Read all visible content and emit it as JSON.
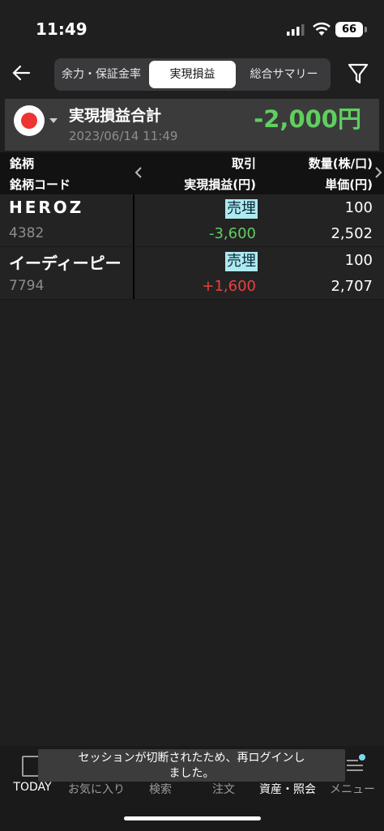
{
  "status": {
    "time": "11:49",
    "battery": "66"
  },
  "nav": {
    "tabs": [
      {
        "label": "余力・保証金率"
      },
      {
        "label": "実現損益"
      },
      {
        "label": "総合サマリー"
      }
    ]
  },
  "summary": {
    "title": "実現損益合計",
    "date": "2023/06/14 11:49",
    "value": "-2,000円"
  },
  "table": {
    "headers": {
      "name": "銘柄",
      "code": "銘柄コード",
      "trade": "取引",
      "pnl": "実現損益(円)",
      "qty": "数量(株/口)",
      "price": "単価(円)"
    },
    "rows": [
      {
        "name": "HEROZ",
        "code": "4382",
        "trade": "売埋",
        "pnl": "-3,600",
        "qty": "100",
        "price": "2,502"
      },
      {
        "name": "イーディーピー",
        "code": "7794",
        "trade": "売埋",
        "pnl": "+1,600",
        "qty": "100",
        "price": "2,707"
      }
    ]
  },
  "toast": {
    "line1": "セッションが切断されたため、再ログインし",
    "line2": "ました。"
  },
  "tabbar": {
    "items": [
      {
        "label": "TODAY"
      },
      {
        "label": "お気に入り"
      },
      {
        "label": "検索"
      },
      {
        "label": "注文"
      },
      {
        "label": "資産・照会"
      },
      {
        "label": "メニュー"
      }
    ]
  }
}
